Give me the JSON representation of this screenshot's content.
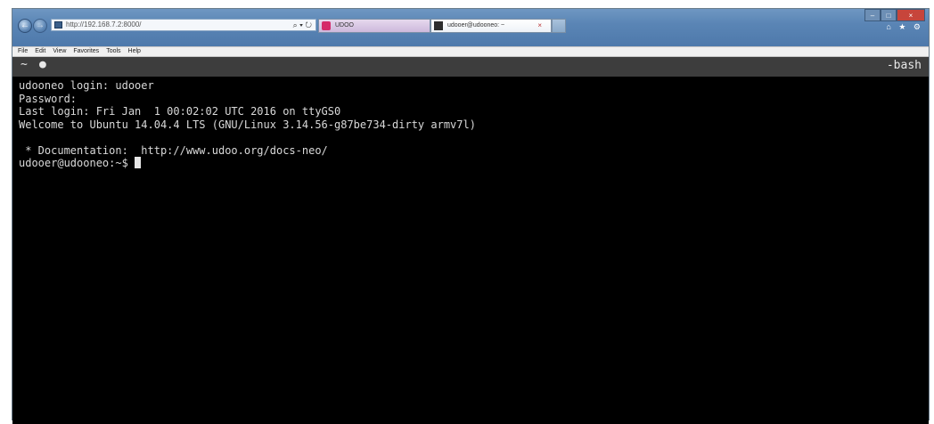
{
  "browser": {
    "address_url": "http://192.168.7.2:8000/",
    "address_tools": "⌕ ▾ ↻",
    "tabs": [
      {
        "label": "UDOO"
      },
      {
        "label": "udooer@udooneo: ~",
        "close": "×"
      }
    ],
    "window_controls": {
      "minimize": "–",
      "maximize": "□",
      "close": "×"
    },
    "right_glyphs": "⌂ ★ ⚙"
  },
  "menu": [
    "File",
    "Edit",
    "View",
    "Favorites",
    "Tools",
    "Help"
  ],
  "terminal": {
    "header_left": "~",
    "header_dot": "●",
    "shell_name": "-bash",
    "lines": [
      "udooneo login: udooer",
      "Password:",
      "Last login: Fri Jan  1 00:02:02 UTC 2016 on ttyGS0",
      "Welcome to Ubuntu 14.04.4 LTS (GNU/Linux 3.14.56-g87be734-dirty armv7l)",
      "",
      " * Documentation:  http://www.udoo.org/docs-neo/",
      "udooer@udooneo:~$ "
    ]
  },
  "colors": {
    "terminal_bg": "#000000",
    "terminal_text": "#d9d9d9",
    "header_bg": "#3d3d3d",
    "tab_udoo_icon": "#d52a6a"
  }
}
